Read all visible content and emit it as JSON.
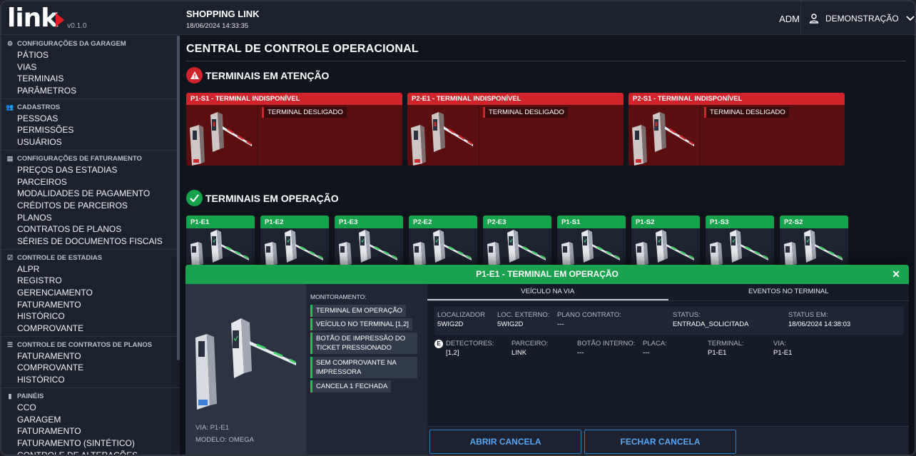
{
  "brand": {
    "logo_text": "link",
    "version": "v0.1.0"
  },
  "topbar": {
    "app_title": "SHOPPING LINK",
    "datetime": "18/06/2024 14:33:35",
    "role": "ADM",
    "user": "DEMONSTRAÇÃO"
  },
  "sidebar": {
    "sections": [
      {
        "title": "CONFIGURAÇÕES DA GARAGEM",
        "icon": "config-icon",
        "items": [
          "PÁTIOS",
          "VIAS",
          "TERMINAIS",
          "PARÂMETROS"
        ]
      },
      {
        "title": "CADASTROS",
        "icon": "people-icon",
        "items": [
          "PESSOAS",
          "PERMISSÕES",
          "USUÁRIOS"
        ]
      },
      {
        "title": "CONFIGURAÇÕES DE FATURAMENTO",
        "icon": "document-icon",
        "items": [
          "PREÇOS DAS ESTADIAS",
          "PARCEIROS",
          "MODALIDADES DE PAGAMENTO",
          "CRÉDITOS DE PARCEIROS",
          "PLANOS",
          "CONTRATOS DE PLANOS",
          "SÉRIES DE DOCUMENTOS FISCAIS"
        ]
      },
      {
        "title": "CONTROLE DE ESTADIAS",
        "icon": "checkbox-icon",
        "items": [
          "ALPR",
          "REGISTRO",
          "GERENCIAMENTO",
          "FATURAMENTO",
          "HISTÓRICO",
          "COMPROVANTE"
        ]
      },
      {
        "title": "CONTROLE DE CONTRATOS DE PLANOS",
        "icon": "sliders-icon",
        "items": [
          "FATURAMENTO",
          "COMPROVANTE",
          "HISTÓRICO"
        ]
      },
      {
        "title": "PAINÉIS",
        "icon": "bar-chart-icon",
        "items": [
          "CCO",
          "GARAGEM",
          "FATURAMENTO",
          "FATURAMENTO (SINTÉTICO)",
          "CONTROLE DE ALTERAÇÕES"
        ]
      }
    ]
  },
  "main": {
    "page_title": "CENTRAL DE CONTROLE OPERACIONAL",
    "attention_title": "TERMINAIS EM ATENÇÃO",
    "operation_title": "TERMINAIS EM OPERAÇÃO",
    "attention_cards": [
      {
        "title": "P1-S1 - TERMINAL INDISPONÍVEL",
        "status": "TERMINAL DESLIGADO"
      },
      {
        "title": "P2-E1 - TERMINAL INDISPONÍVEL",
        "status": "TERMINAL DESLIGADO"
      },
      {
        "title": "P2-S1 - TERMINAL INDISPONÍVEL",
        "status": "TERMINAL DESLIGADO"
      }
    ],
    "operation_cards": [
      "P1-E1",
      "P1-E2",
      "P1-E3",
      "P2-E2",
      "P2-E3",
      "P1-S1",
      "P1-S2",
      "P1-S3",
      "P2-S2"
    ]
  },
  "modal": {
    "title": "P1-E1 - TERMINAL EM OPERAÇÃO",
    "via": "VIA: P1-E1",
    "modelo": "MODELO: OMEGA",
    "monitor_label": "MONITORAMENTO:",
    "monitor_tags": [
      "TERMINAL EM OPERAÇÃO",
      "VEÍCULO NO TERMINAL [1,2]",
      "BOTÃO DE IMPRESSÃO DO TICKET PRESSIONADO",
      "SEM COMPROVANTE NA IMPRESSORA",
      "CANCELA 1 FECHADA"
    ],
    "tabs": [
      "VEÍCULO NA VIA",
      "EVENTOS NO TERMINAL"
    ],
    "fields": {
      "localizador": {
        "label": "LOCALIZADOR",
        "value": "5WIG2D"
      },
      "loc_externo": {
        "label": "LOC. EXTERNO:",
        "value": "5WIG2D"
      },
      "plano_contrato": {
        "label": "PLANO CONTRATO:",
        "value": "---"
      },
      "status": {
        "label": "STATUS:",
        "value": "ENTRADA_SOLICITADA"
      },
      "status_em": {
        "label": "STATUS EM:",
        "value": "18/06/2024 14:38:03"
      },
      "detectores": {
        "label": "DETECTORES:",
        "value": "[1,2]"
      },
      "parceiro": {
        "label": "PARCEIRO:",
        "value": "LINK"
      },
      "botao_interno": {
        "label": "BOTÃO INTERNO:",
        "value": "---"
      },
      "placa": {
        "label": "PLACA:",
        "value": "---"
      },
      "terminal": {
        "label": "TERMINAL:",
        "value": "P1-E1"
      },
      "via": {
        "label": "VIA:",
        "value": "P1-E1"
      }
    },
    "badge": "E",
    "buttons": {
      "open": "ABRIR CANCELA",
      "close": "FECHAR CANCELA"
    }
  },
  "colors": {
    "alert_red": "#d1232a",
    "ok_green": "#1aa34c",
    "action_blue": "#56a7f1"
  }
}
